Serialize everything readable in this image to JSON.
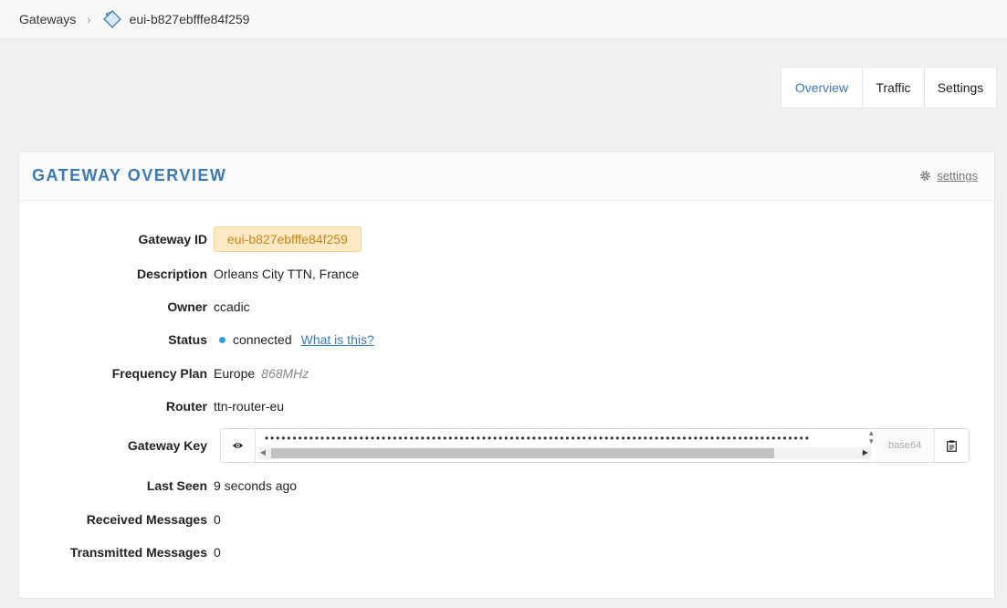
{
  "breadcrumb": {
    "root": "Gateways",
    "current": "eui-b827ebfffe84f259"
  },
  "tabs": [
    {
      "label": "Overview",
      "active": true
    },
    {
      "label": "Traffic",
      "active": false
    },
    {
      "label": "Settings",
      "active": false
    }
  ],
  "panel": {
    "title": "Gateway Overview",
    "settings_link": "settings",
    "fields": {
      "gateway_id": {
        "label": "Gateway ID",
        "value": "eui-b827ebfffe84f259"
      },
      "description": {
        "label": "Description",
        "value": "Orleans City TTN, France"
      },
      "owner": {
        "label": "Owner",
        "value": "ccadic"
      },
      "status": {
        "label": "Status",
        "value": "connected",
        "help": "What is this?"
      },
      "frequency_plan": {
        "label": "Frequency Plan",
        "value": "Europe",
        "sub": "868MHz"
      },
      "router": {
        "label": "Router",
        "value": "ttn-router-eu"
      },
      "gateway_key": {
        "label": "Gateway Key",
        "masked": "••••••••••••••••••••••••••••••••••••••••••••••••••••••••••••••••••••••••••••••••••••••••••••••••••",
        "format": "base64"
      },
      "last_seen": {
        "label": "Last Seen",
        "value": "9 seconds ago"
      },
      "received": {
        "label": "Received Messages",
        "value": "0"
      },
      "transmitted": {
        "label": "Transmitted Messages",
        "value": "0"
      }
    }
  },
  "colors": {
    "accent": "#3c7ab0",
    "badge_bg": "#fde9c4",
    "badge_text": "#c9841a",
    "status_dot": "#2a9fd8"
  },
  "icons": {
    "breadcrumb_separator": "chevron-right-icon",
    "gateway": "gateway-icon",
    "settings": "gear-icon",
    "show_key": "eye-icon",
    "copy_key": "clipboard-icon"
  }
}
